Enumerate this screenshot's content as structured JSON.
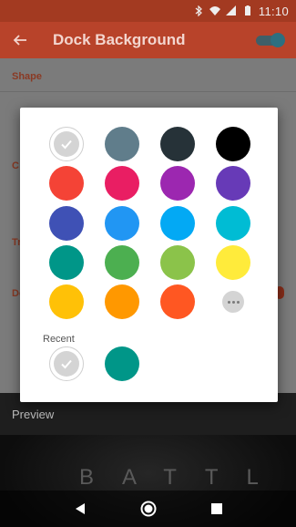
{
  "status_bar": {
    "time": "11:10",
    "icons": [
      "bluetooth-icon",
      "wifi-icon",
      "signal-icon",
      "battery-icon"
    ]
  },
  "app_bar": {
    "title": "Dock Background",
    "back_icon": "arrow-back-icon",
    "toggle_on": true
  },
  "settings": {
    "shape_label": "Shape",
    "row2_label": "C",
    "row3_label": "Tr",
    "row4_label": "Do"
  },
  "preview": {
    "label": "Preview",
    "sample_text": "BATTL"
  },
  "color_picker": {
    "recent_label": "Recent",
    "more_icon": "more-horiz-icon",
    "selected_icon": "check-icon",
    "palette": [
      {
        "name": "transparent",
        "color": "#ffffff",
        "selected": true
      },
      {
        "name": "blue-grey",
        "color": "#607d8b"
      },
      {
        "name": "dark-grey",
        "color": "#263238"
      },
      {
        "name": "black",
        "color": "#000000"
      },
      {
        "name": "red",
        "color": "#f44336"
      },
      {
        "name": "pink",
        "color": "#e91e63"
      },
      {
        "name": "purple",
        "color": "#9c27b0"
      },
      {
        "name": "deep-purple",
        "color": "#673ab7"
      },
      {
        "name": "indigo",
        "color": "#3f51b5"
      },
      {
        "name": "blue",
        "color": "#2196f3"
      },
      {
        "name": "light-blue",
        "color": "#03a9f4"
      },
      {
        "name": "cyan",
        "color": "#00bcd4"
      },
      {
        "name": "teal",
        "color": "#009688"
      },
      {
        "name": "green",
        "color": "#4caf50"
      },
      {
        "name": "light-green",
        "color": "#8bc34a"
      },
      {
        "name": "yellow",
        "color": "#ffeb3b"
      },
      {
        "name": "amber",
        "color": "#ffc107"
      },
      {
        "name": "orange",
        "color": "#ff9800"
      },
      {
        "name": "deep-orange",
        "color": "#ff5722"
      }
    ],
    "recent": [
      {
        "name": "transparent",
        "color": "#ffffff",
        "selected": true
      },
      {
        "name": "teal",
        "color": "#009688"
      }
    ]
  },
  "nav_bar": {
    "icons": [
      "back-triangle-icon",
      "home-circle-icon",
      "recents-square-icon"
    ]
  }
}
